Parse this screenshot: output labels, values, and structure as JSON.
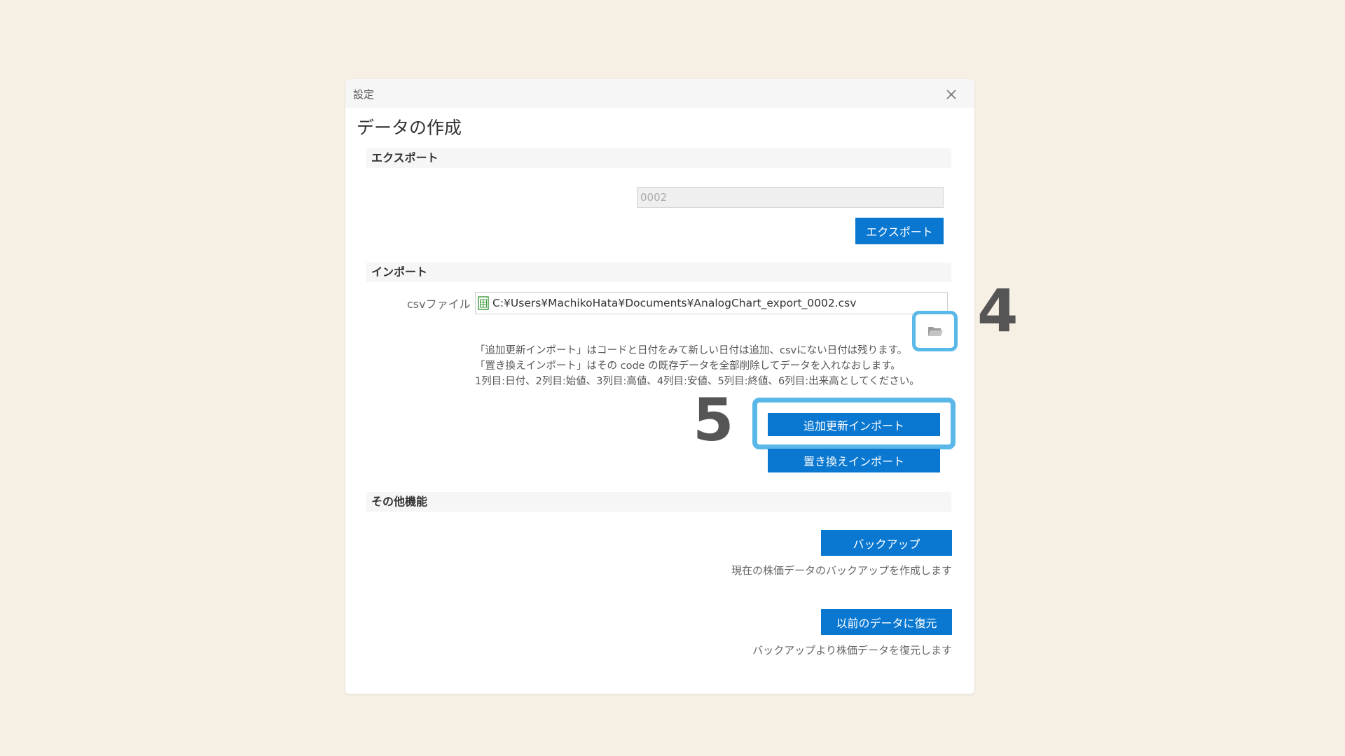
{
  "dialog": {
    "title": "設定",
    "heading": "データの作成"
  },
  "export": {
    "section_label": "エクスポート",
    "code_value": "0002",
    "button_label": "エクスポート"
  },
  "import": {
    "section_label": "インポート",
    "file_label": "csvファイル",
    "file_path": "C:¥Users¥MachikoHata¥Documents¥AnalogChart_export_0002.csv",
    "notes": [
      "「追加更新インポート」はコードと日付をみて新しい日付は追加、csvにない日付は残ります。",
      "「置き換えインポート」はその code の既存データを全部削除してデータを入れなおします。",
      "1列目:日付、2列目:始値、3列目:高値、4列目:安値、5列目:終値、6列目:出来高としてください。"
    ],
    "append_button_label": "追加更新インポート",
    "replace_button_label": "置き換えインポート"
  },
  "other": {
    "section_label": "その他機能",
    "backup_button_label": "バックアップ",
    "backup_hint": "現在の株価データのバックアップを作成します",
    "restore_button_label": "以前のデータに復元",
    "restore_hint": "バックアップより株価データを復元します"
  },
  "annotations": {
    "step_4": "4",
    "step_5": "5"
  },
  "icons": {
    "close": "close-icon",
    "csv_file": "spreadsheet-file-icon",
    "folder": "folder-open-icon"
  },
  "colors": {
    "primary_button": "#0a78d1",
    "highlight": "#5ab8e8",
    "background": "#f6efe4"
  }
}
